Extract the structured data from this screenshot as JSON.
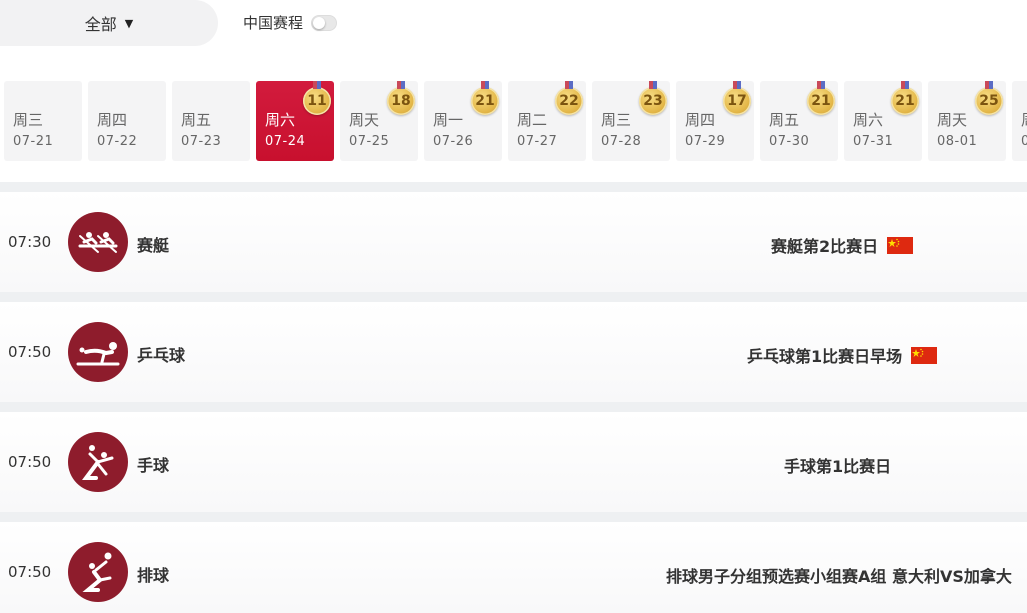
{
  "filter": {
    "label": "全部"
  },
  "china_toggle": {
    "label": "中国赛程",
    "on": false
  },
  "dates": [
    {
      "weekday": "周三",
      "date": "07-21",
      "medals": null,
      "active": false
    },
    {
      "weekday": "周四",
      "date": "07-22",
      "medals": null,
      "active": false
    },
    {
      "weekday": "周五",
      "date": "07-23",
      "medals": null,
      "active": false
    },
    {
      "weekday": "周六",
      "date": "07-24",
      "medals": "11",
      "active": true
    },
    {
      "weekday": "周天",
      "date": "07-25",
      "medals": "18",
      "active": false
    },
    {
      "weekday": "周一",
      "date": "07-26",
      "medals": "21",
      "active": false
    },
    {
      "weekday": "周二",
      "date": "07-27",
      "medals": "22",
      "active": false
    },
    {
      "weekday": "周三",
      "date": "07-28",
      "medals": "23",
      "active": false
    },
    {
      "weekday": "周四",
      "date": "07-29",
      "medals": "17",
      "active": false
    },
    {
      "weekday": "周五",
      "date": "07-30",
      "medals": "21",
      "active": false
    },
    {
      "weekday": "周六",
      "date": "07-31",
      "medals": "21",
      "active": false
    },
    {
      "weekday": "周天",
      "date": "08-01",
      "medals": "25",
      "active": false
    },
    {
      "weekday": "周",
      "date": "0",
      "medals": null,
      "active": false
    }
  ],
  "events": [
    {
      "time": "07:30",
      "sport": "赛艇",
      "icon": "rowing-icon",
      "title": "赛艇第2比赛日",
      "china": true
    },
    {
      "time": "07:50",
      "sport": "乒乓球",
      "icon": "table-tennis-icon",
      "title": "乒乓球第1比赛日早场",
      "china": true
    },
    {
      "time": "07:50",
      "sport": "手球",
      "icon": "handball-icon",
      "title": "手球第1比赛日",
      "china": false
    },
    {
      "time": "07:50",
      "sport": "排球",
      "icon": "volleyball-icon",
      "title": "排球男子分组预选赛小组赛A组 意大利VS加拿大",
      "china": false
    }
  ],
  "colors": {
    "active_date": "#c8102e",
    "sport_icon_bg": "#8e1c2c",
    "medal_gold": "#e4b84a",
    "china_flag_red": "#de2910"
  }
}
